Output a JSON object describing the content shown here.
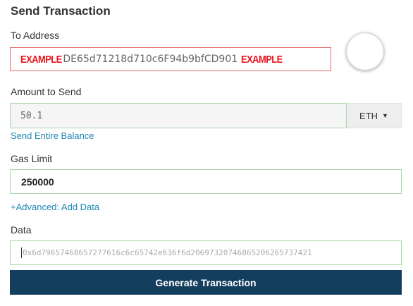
{
  "page": {
    "title": "Send Transaction"
  },
  "to_address": {
    "label": "To Address",
    "example_prefix": "EXAMPLE",
    "value": "DE65d71218d710c6F94b9bfCD901",
    "example_suffix": "EXAMPLE"
  },
  "amount": {
    "label": "Amount to Send",
    "value": "50.1",
    "currency": "ETH",
    "send_entire_balance_label": "Send Entire Balance"
  },
  "gas": {
    "label": "Gas Limit",
    "value": "250000",
    "advanced_label": "+Advanced: Add Data"
  },
  "data_field": {
    "label": "Data",
    "placeholder": "0x6d79657468657277616c6c65742e636f6d20697320746865206265737421"
  },
  "generate_button": {
    "label": "Generate Transaction"
  },
  "colors": {
    "button_bg": "#143e5e",
    "link": "#1f8ab5",
    "valid_border": "#a9d8a9",
    "invalid_border": "#e36a6a",
    "example_red": "#e8141b"
  }
}
